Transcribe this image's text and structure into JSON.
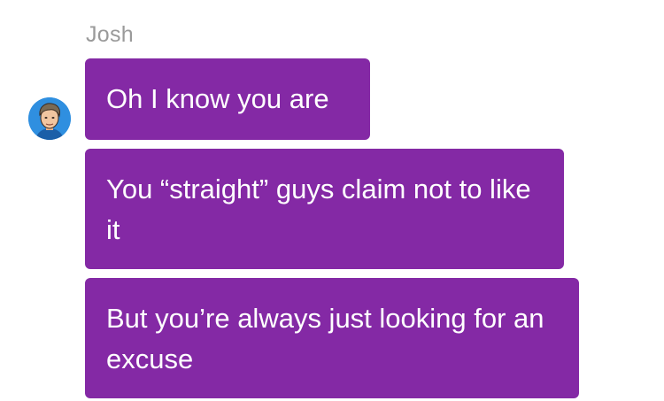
{
  "conversation": {
    "sender_name": "Josh",
    "avatar_icon": "user-avatar-icon",
    "bubble_color": "#8429a5",
    "messages": [
      {
        "text": "Oh I know you are"
      },
      {
        "text": "You “straight” guys claim not to like it"
      },
      {
        "text": "But you’re always just looking for an excuse"
      }
    ]
  }
}
